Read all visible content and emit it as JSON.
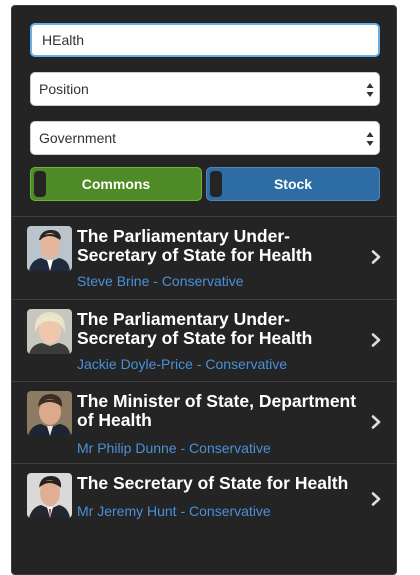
{
  "search": {
    "value": "HEalth"
  },
  "filters": {
    "position": "Position",
    "government": "Government"
  },
  "toggles": {
    "commons": "Commons",
    "stock": "Stock"
  },
  "results": [
    {
      "title": "The Parliamentary Under-Secretary of State for Health",
      "subtitle": "Steve Brine - Conservative"
    },
    {
      "title": "The Parliamentary Under-Secretary of State for Health",
      "subtitle": "Jackie Doyle-Price - Conservative"
    },
    {
      "title": "The Minister of State, Department of Health",
      "subtitle": "Mr Philip Dunne - Conservative"
    },
    {
      "title": "The Secretary of State for Health",
      "subtitle": "Mr Jeremy Hunt - Conservative"
    }
  ],
  "colors": {
    "panel_bg": "#242424",
    "commons_green": "#4e8a25",
    "stock_blue": "#2e6da4",
    "link_blue": "#4a90d9"
  },
  "icons": {
    "select_arrows": "up-down-arrows-icon",
    "row_chevron": "chevron-right-icon"
  }
}
